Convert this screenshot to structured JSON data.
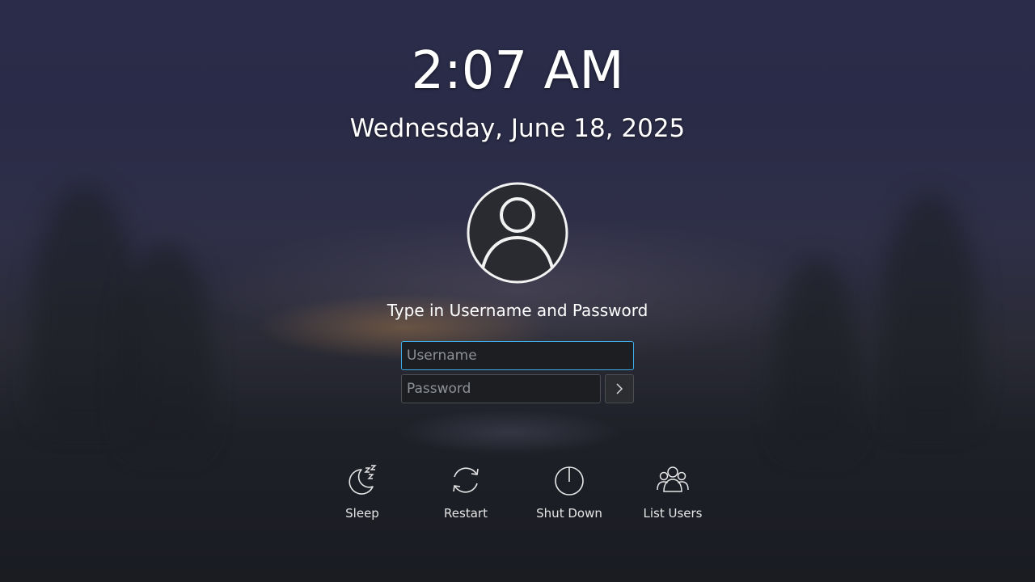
{
  "clock": {
    "time": "2:07 AM",
    "date": "Wednesday, June 18, 2025"
  },
  "login": {
    "prompt": "Type in Username and Password",
    "username_placeholder": "Username",
    "username_value": "",
    "password_placeholder": "Password",
    "password_value": ""
  },
  "actions": [
    {
      "label": "Sleep",
      "icon": "sleep-icon"
    },
    {
      "label": "Restart",
      "icon": "restart-icon"
    },
    {
      "label": "Shut Down",
      "icon": "power-icon"
    },
    {
      "label": "List Users",
      "icon": "users-icon"
    }
  ],
  "colors": {
    "focus_accent": "#3daee9",
    "field_background": "#1c1e22",
    "text": "#ffffff"
  }
}
